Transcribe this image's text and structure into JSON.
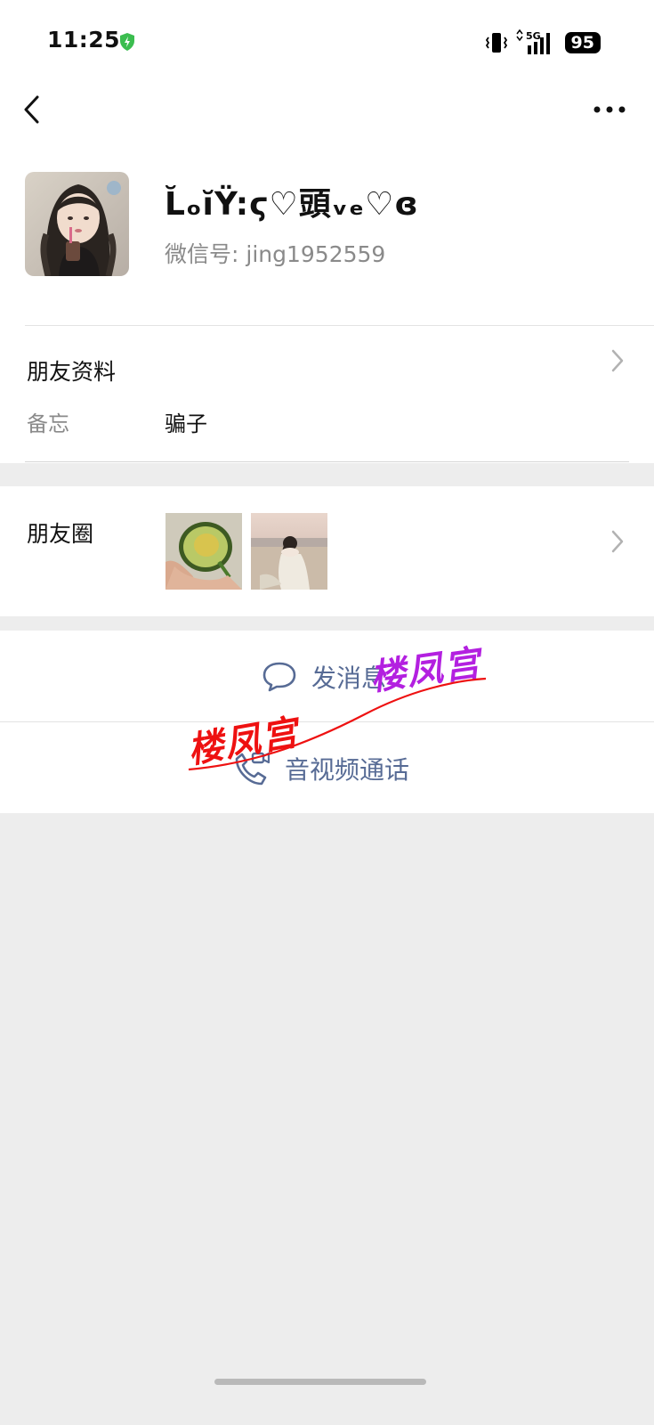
{
  "status_bar": {
    "time": "11:25",
    "network": "5G",
    "battery": "95"
  },
  "profile": {
    "nickname": "L̆ₒĭŸ:ϛ♡頭ᵥₑ♡ɞ",
    "wechat_id_label": "微信号:",
    "wechat_id": "jing1952559"
  },
  "friend_info": {
    "title": "朋友资料",
    "remark_label": "备忘",
    "remark_value": "骗子"
  },
  "moments": {
    "title": "朋友圈"
  },
  "actions": {
    "send_message": "发消息",
    "av_call": "音视频通话"
  },
  "watermark": {
    "text_red": "楼凤宫",
    "text_purple": "楼凤宫",
    "color_red": "#ee1111",
    "color_purple": "#b320e0"
  },
  "icons": {
    "back": "chevron-left-icon",
    "more": "more-dots-icon",
    "shield": "security-shield-icon",
    "chat": "chat-bubble-icon",
    "call": "video-call-icon"
  },
  "colors": {
    "link_blue": "#576b95",
    "background": "#ededed",
    "security_green": "#3bbd4f"
  }
}
